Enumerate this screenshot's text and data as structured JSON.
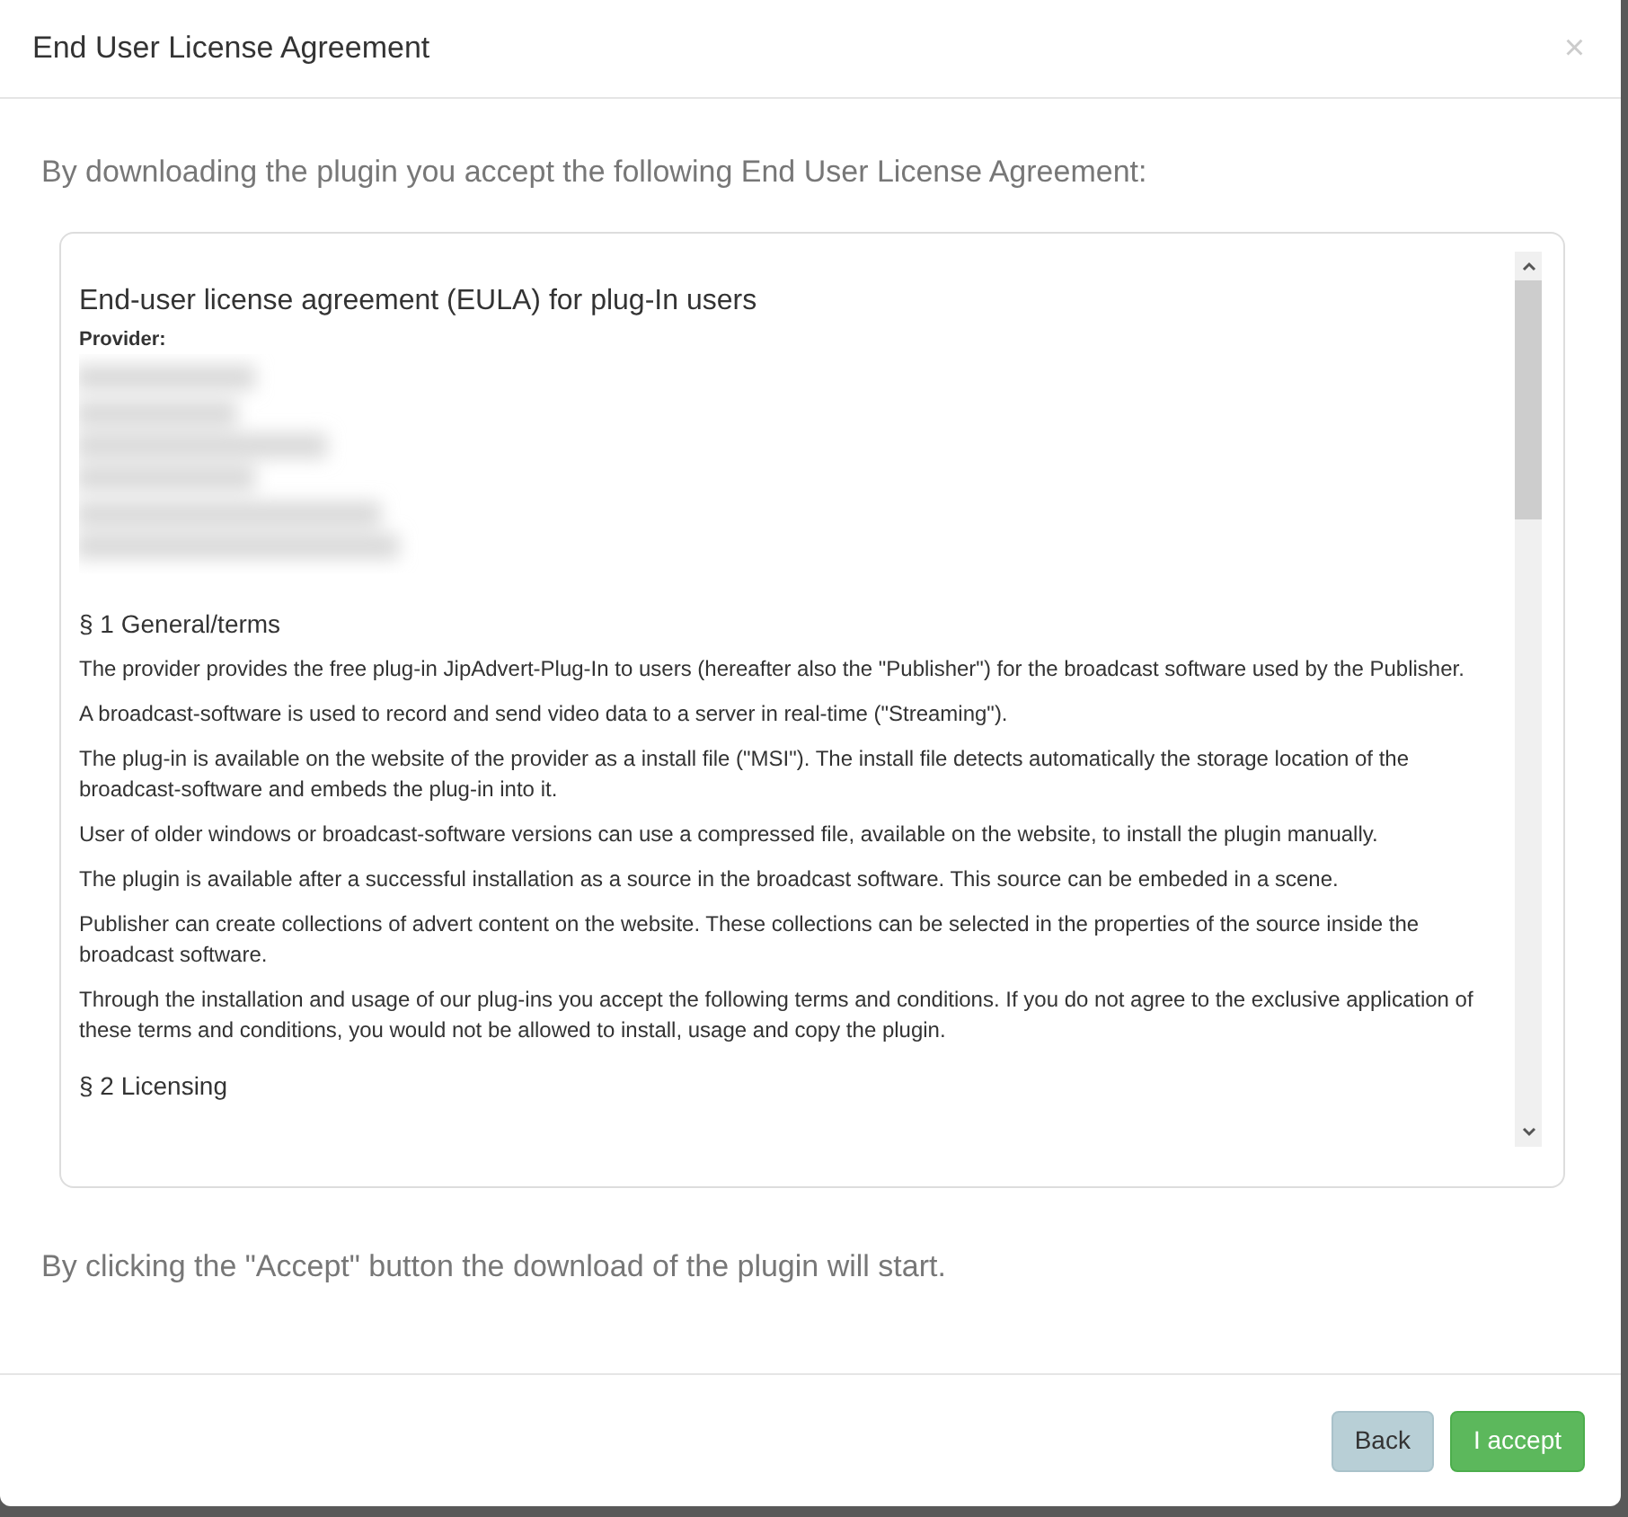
{
  "dialog": {
    "title": "End User License Agreement",
    "close": "×",
    "intro": "By downloading the plugin you accept the following End User License Agreement:",
    "eula": {
      "heading": "End-user license agreement (EULA) for plug-In users",
      "provider_label": "Provider:",
      "sections": [
        {
          "kind": "heading",
          "text": "§ 1 General/terms"
        },
        {
          "kind": "paragraph",
          "text": "The provider provides the free plug-in JipAdvert-Plug-In to users (hereafter also the \"Publisher\") for the broadcast software used by the Publisher."
        },
        {
          "kind": "paragraph",
          "text": "A broadcast-software is used to record and send video data to a server in real-time (\"Streaming\")."
        },
        {
          "kind": "paragraph",
          "text": "The plug-in is available on the website of the provider as a install file (\"MSI\"). The install file detects automatically the storage location of the broadcast-software and embeds the plug-in into it."
        },
        {
          "kind": "paragraph",
          "text": "User of older windows or broadcast-software versions can use a compressed file, available on the website, to install the plugin manually."
        },
        {
          "kind": "paragraph",
          "text": "The plugin is available after a successful installation as a source in the broadcast software. This source can be embeded in a scene."
        },
        {
          "kind": "paragraph",
          "text": "Publisher can create collections of advert content on the website. These collections can be selected in the properties of the source inside the broadcast software."
        },
        {
          "kind": "paragraph",
          "text": "Through the installation and usage of our plug-ins you accept the following terms and conditions. If you do not agree to the exclusive application of these terms and conditions, you would not be allowed to install, usage and copy the plugin."
        },
        {
          "kind": "heading",
          "text": "§ 2 Licensing"
        }
      ]
    },
    "note": "By clicking the \"Accept\" button the download of the plugin will start.",
    "buttons": [
      {
        "kind": "secondary",
        "label": "Back"
      },
      {
        "kind": "primary",
        "label": "I accept"
      }
    ]
  }
}
